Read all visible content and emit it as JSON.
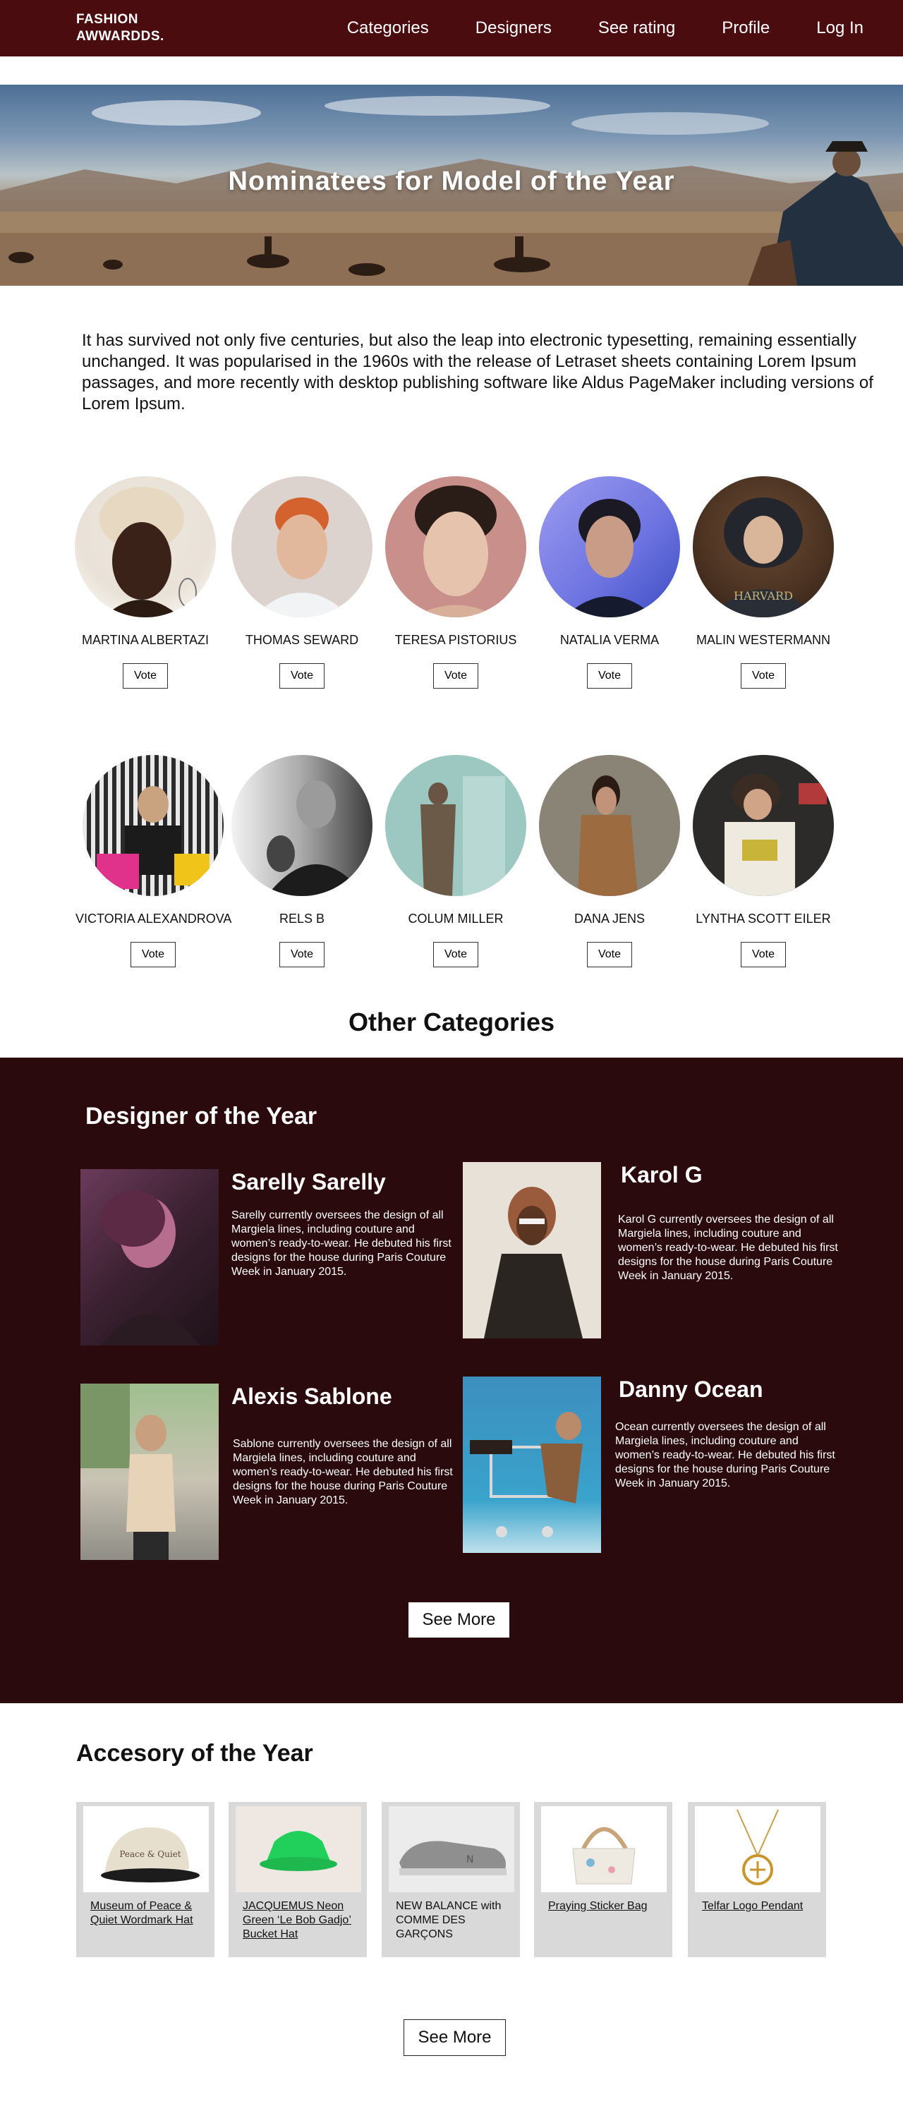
{
  "nav": {
    "logo_line1": "FASHION",
    "logo_line2": "AWWARDDS.",
    "links": [
      "Categories",
      "Designers",
      "See rating",
      "Profile",
      "Log In"
    ]
  },
  "hero": {
    "title": "Nominatees for Model of the Year"
  },
  "intro": "It has survived not only five centuries, but also the leap into electronic typesetting, remaining essentially unchanged. It was popularised in the 1960s with the release of Letraset sheets containing Lorem Ipsum passages, and more recently with desktop publishing software like Aldus PageMaker including versions of Lorem Ipsum.",
  "nominees": [
    {
      "name": "MARTINA ALBERTAZI",
      "vote": "Vote"
    },
    {
      "name": "THOMAS SEWARD",
      "vote": "Vote"
    },
    {
      "name": "TERESA PISTORIUS",
      "vote": "Vote"
    },
    {
      "name": "NATALIA VERMA",
      "vote": "Vote"
    },
    {
      "name": "MALIN WESTERMANN",
      "vote": "Vote"
    },
    {
      "name": "VICTORIA ALEXANDROVA",
      "vote": "Vote"
    },
    {
      "name": "RELS B",
      "vote": "Vote"
    },
    {
      "name": "COLUM MILLER",
      "vote": "Vote"
    },
    {
      "name": "DANA JENS",
      "vote": "Vote"
    },
    {
      "name": "LYNTHA SCOTT EILER",
      "vote": "Vote"
    }
  ],
  "other_categories": "Other Categories",
  "designers": {
    "heading": "Designer of the Year",
    "items": [
      {
        "name": "Sarelly Sarelly",
        "desc": "Sarelly currently oversees the design of all Margiela lines, including couture and women’s ready-to-wear. He debuted his first designs for the house during Paris Couture Week in January 2015."
      },
      {
        "name": "Karol G",
        "desc": "Karol G currently oversees the design of all Margiela lines, including couture and women’s ready-to-wear. He debuted his first designs for the house during Paris Couture Week in January 2015."
      },
      {
        "name": "Alexis Sablone",
        "desc": "Sablone currently oversees the design of all Margiela lines, including couture and women’s ready-to-wear. He debuted his first designs for the house during Paris Couture Week in January 2015."
      },
      {
        "name": "Danny Ocean",
        "desc": "Ocean currently oversees the design of all Margiela lines, including couture and women’s ready-to-wear. He debuted his first designs for the house during Paris Couture Week in January 2015."
      }
    ],
    "see_more": "See More"
  },
  "accessory": {
    "heading": "Accesory of the Year",
    "items": [
      {
        "text": "Museum of Peace & Quiet Wordmark Hat",
        "cap_text": "Peace & Quiet"
      },
      {
        "text": "JACQUEMUS Neon Green ‘Le Bob Gadjo’ Bucket Hat"
      },
      {
        "text": "NEW BALANCE with COMME DES GARÇONS"
      },
      {
        "text": "Praying Sticker Bag"
      },
      {
        "text": "Telfar Logo Pendant"
      }
    ],
    "see_more": "See More"
  }
}
